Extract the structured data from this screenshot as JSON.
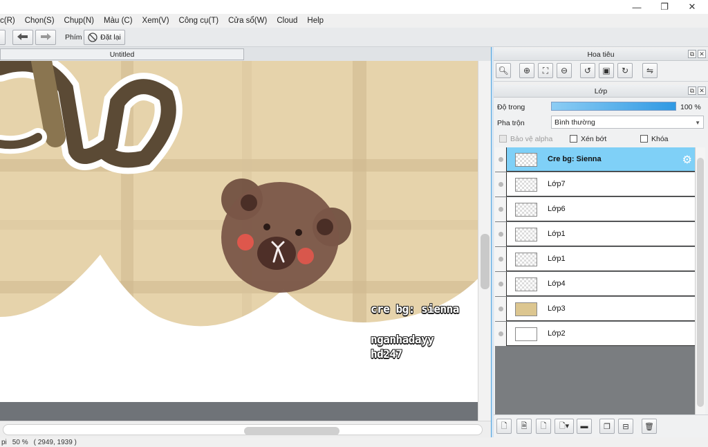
{
  "menu": [
    "c(R)",
    "Chọn(S)",
    "Chụp(N)",
    "Màu (C)",
    "Xem(V)",
    "Công cụ(T)",
    "Cửa sổ(W)",
    "Cloud",
    "Help"
  ],
  "toolbar": {
    "phim_label": "Phím",
    "reset_label": "Đặt lại"
  },
  "document": {
    "tab_title": "Untitled"
  },
  "canvas_text": {
    "credit": "cre bg: sienna",
    "author_line1": "nganhadayy",
    "author_line2": "hd247"
  },
  "navigator": {
    "title": "Hoa tiêu"
  },
  "layers_panel": {
    "title": "Lớp",
    "opacity_label": "Độ trong",
    "opacity_value": "100 %",
    "opacity_fraction": 1.0,
    "blend_label": "Pha trộn",
    "blend_value": "Bình thường",
    "protect_alpha": "Bảo vệ alpha",
    "clipping": "Xén bớt",
    "lock": "Khóa",
    "layers": [
      {
        "name": "Cre bg: Sienna",
        "selected": true
      },
      {
        "name": "Lớp7",
        "selected": false
      },
      {
        "name": "Lớp6",
        "selected": false
      },
      {
        "name": "Lớp1",
        "selected": false
      },
      {
        "name": "Lớp1",
        "selected": false
      },
      {
        "name": "Lớp4",
        "selected": false
      },
      {
        "name": "Lớp3",
        "selected": false
      },
      {
        "name": "Lớp2",
        "selected": false
      }
    ]
  },
  "status": {
    "dpi_fragment": "pi",
    "zoom": "50 %",
    "coords": "( 2949, 1939 )"
  },
  "colors": {
    "selected_layer": "#7fd0f7",
    "opacity_bar": "#2f99e3",
    "canvas_bg": "#e2cfa6"
  }
}
